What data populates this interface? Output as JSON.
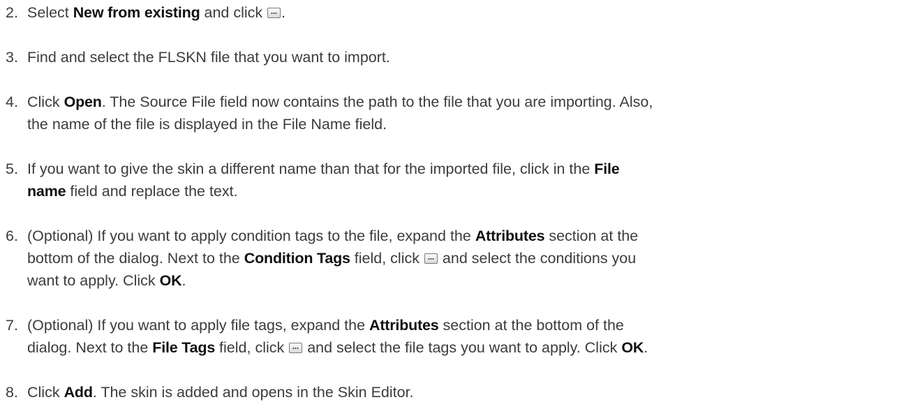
{
  "steps": [
    {
      "num": "2.",
      "lines": [
        [
          {
            "t": "text",
            "v": "Select "
          },
          {
            "t": "ui",
            "v": "New from existing"
          },
          {
            "t": "text",
            "v": " and click "
          },
          {
            "t": "icon",
            "v": "browse-button-icon"
          },
          {
            "t": "text",
            "v": "."
          }
        ]
      ]
    },
    {
      "num": "3.",
      "lines": [
        [
          {
            "t": "text",
            "v": "Find and select the FLSKN file that you want to import."
          }
        ]
      ]
    },
    {
      "num": "4.",
      "lines": [
        [
          {
            "t": "text",
            "v": "Click "
          },
          {
            "t": "ui",
            "v": "Open"
          },
          {
            "t": "text",
            "v": ". The Source File field now contains the path to the file that you are importing. Also,"
          }
        ],
        [
          {
            "t": "text",
            "v": "the name of the file is displayed in the File Name field."
          }
        ]
      ]
    },
    {
      "num": "5.",
      "lines": [
        [
          {
            "t": "text",
            "v": "If you want to give the skin a different name than that for the imported file, click in the "
          },
          {
            "t": "ui",
            "v": "File"
          }
        ],
        [
          {
            "t": "ui",
            "v": "name"
          },
          {
            "t": "text",
            "v": " field and replace the text."
          }
        ]
      ]
    },
    {
      "num": "6.",
      "lines": [
        [
          {
            "t": "text",
            "v": "(Optional) If you want to apply condition tags to the file, expand the "
          },
          {
            "t": "ui",
            "v": "Attributes"
          },
          {
            "t": "text",
            "v": " section at the"
          }
        ],
        [
          {
            "t": "text",
            "v": "bottom of the dialog. Next to the "
          },
          {
            "t": "ui",
            "v": "Condition Tags"
          },
          {
            "t": "text",
            "v": " field, click "
          },
          {
            "t": "icon",
            "v": "browse-button-icon"
          },
          {
            "t": "text",
            "v": " and select the conditions you"
          }
        ],
        [
          {
            "t": "text",
            "v": "want to apply. Click "
          },
          {
            "t": "ui",
            "v": "OK"
          },
          {
            "t": "text",
            "v": "."
          }
        ]
      ]
    },
    {
      "num": "7.",
      "lines": [
        [
          {
            "t": "text",
            "v": "(Optional) If you want to apply file tags, expand the "
          },
          {
            "t": "ui",
            "v": "Attributes"
          },
          {
            "t": "text",
            "v": " section at the bottom of the"
          }
        ],
        [
          {
            "t": "text",
            "v": "dialog. Next to the "
          },
          {
            "t": "ui",
            "v": "File Tags"
          },
          {
            "t": "text",
            "v": " field, click "
          },
          {
            "t": "icon",
            "v": "browse-button-icon"
          },
          {
            "t": "text",
            "v": " and select the file tags you want to apply. Click "
          },
          {
            "t": "ui",
            "v": "OK"
          },
          {
            "t": "text",
            "v": "."
          }
        ]
      ]
    },
    {
      "num": "8.",
      "lines": [
        [
          {
            "t": "text",
            "v": "Click "
          },
          {
            "t": "ui",
            "v": "Add"
          },
          {
            "t": "text",
            "v": ". The skin is added and opens in the Skin Editor."
          }
        ]
      ]
    }
  ]
}
